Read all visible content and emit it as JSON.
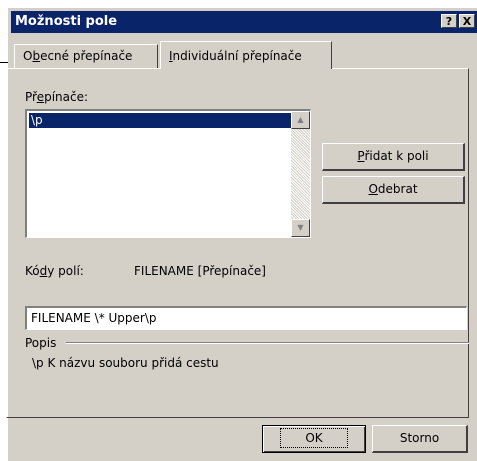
{
  "window": {
    "title": "Možnosti pole",
    "help_label": "?",
    "close_label": "X"
  },
  "tabs": [
    {
      "label_pre": "O",
      "label_key": "b",
      "label_post": "ecné přepínače"
    },
    {
      "label_pre": "",
      "label_key": "I",
      "label_post": "ndividuální přepínače"
    }
  ],
  "switches": {
    "label_pre": "Př",
    "label_key": "e",
    "label_post": "pínače:",
    "items": [
      "\\p"
    ]
  },
  "buttons": {
    "add_key": "P",
    "add_rest": "řidat k poli",
    "remove_key": "O",
    "remove_rest": "debrat",
    "ok": "OK",
    "cancel": "Storno"
  },
  "field_codes": {
    "label_pre": "Kó",
    "label_key": "d",
    "label_post": "y polí:",
    "value": "FILENAME [Přepínače]",
    "input_value": "FILENAME \\* Upper\\p"
  },
  "description": {
    "group_label": "Popis",
    "text": "\\p K názvu souboru přidá cestu"
  }
}
